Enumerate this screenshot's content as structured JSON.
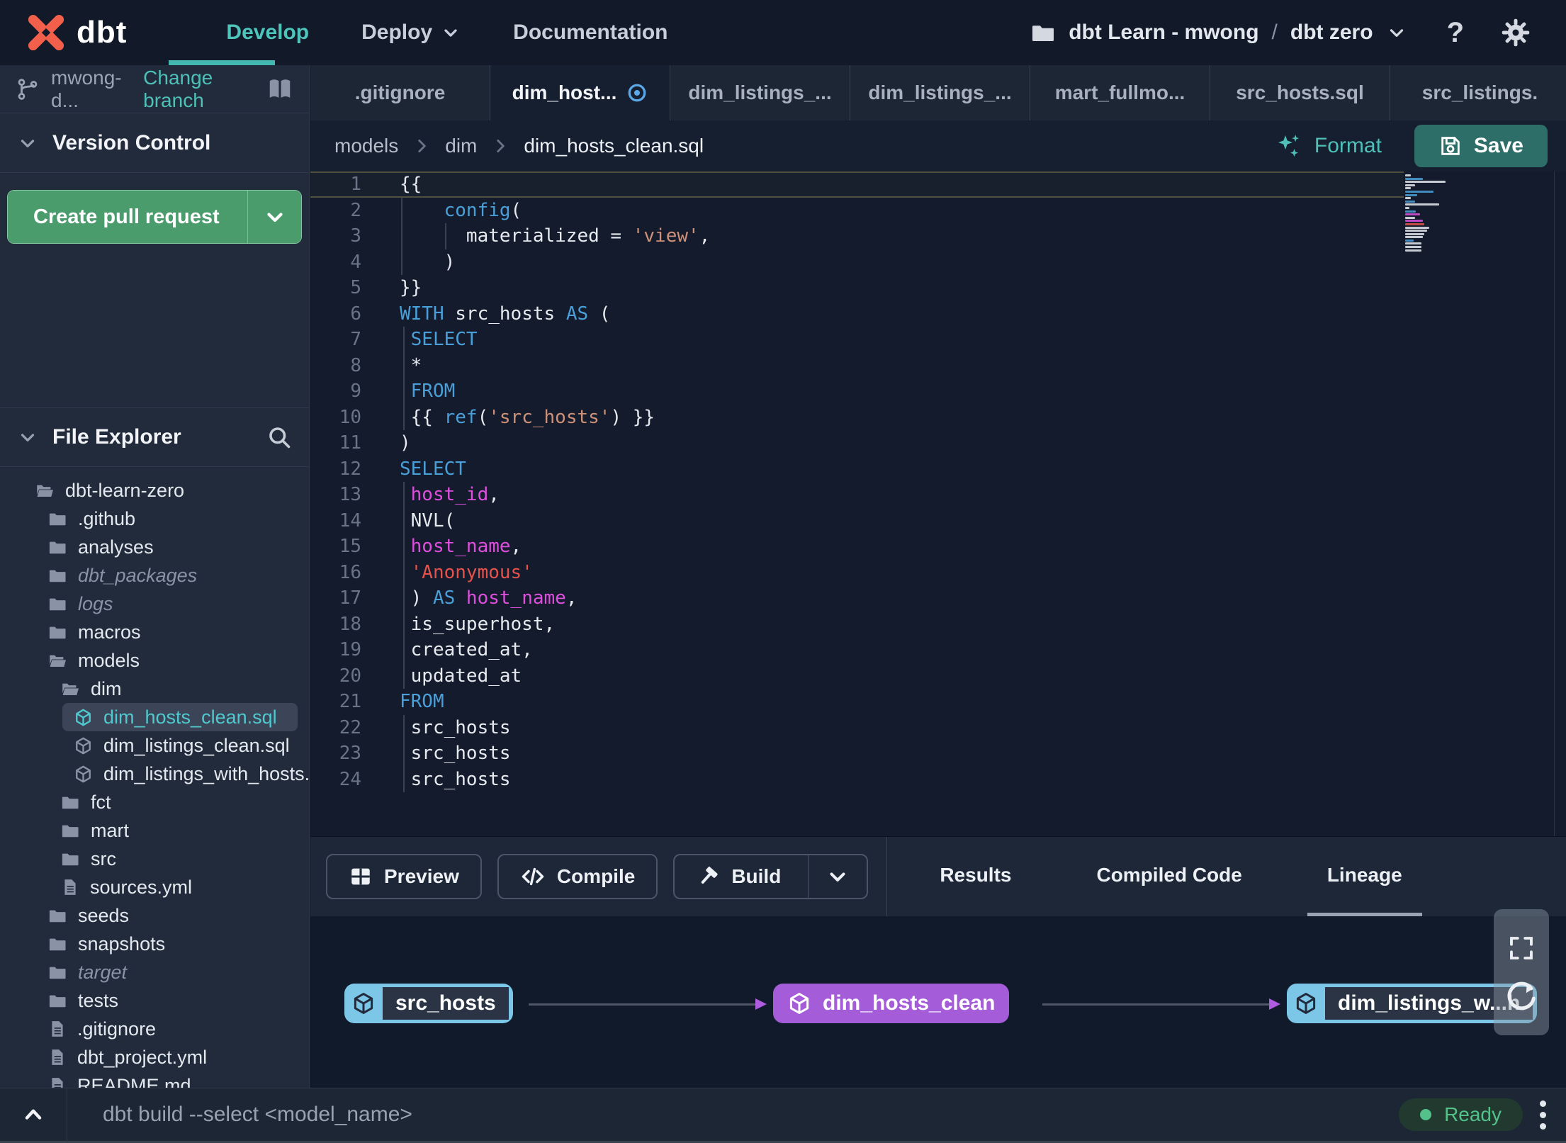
{
  "nav": {
    "brand": "dbt",
    "items": [
      {
        "label": "Develop",
        "active": true,
        "caret": false
      },
      {
        "label": "Deploy",
        "active": false,
        "caret": true
      },
      {
        "label": "Documentation",
        "active": false,
        "caret": false
      }
    ],
    "project_breadcrumb": {
      "account": "dbt Learn - mwong",
      "divider": "/",
      "project": "dbt zero",
      "folder_icon": "folder-icon",
      "caret_icon": "chevron-down-icon"
    },
    "help_icon": "question-mark-icon",
    "settings_icon": "gear-icon"
  },
  "sidebar": {
    "branch": {
      "icon": "git-branch-icon",
      "name": "mwong-d...",
      "change_link": "Change branch",
      "docs_icon": "book-icon"
    },
    "version_control": {
      "title": "Version Control",
      "create_pr_label": "Create pull request"
    },
    "file_explorer": {
      "title": "File Explorer",
      "search_icon": "search-icon",
      "tree": [
        {
          "label": "dbt-learn-zero",
          "type": "folder-open",
          "level": 0
        },
        {
          "label": ".github",
          "type": "folder",
          "level": 1
        },
        {
          "label": "analyses",
          "type": "folder",
          "level": 1
        },
        {
          "label": "dbt_packages",
          "type": "folder",
          "level": 1,
          "muted": true
        },
        {
          "label": "logs",
          "type": "folder",
          "level": 1,
          "muted": true
        },
        {
          "label": "macros",
          "type": "folder",
          "level": 1
        },
        {
          "label": "models",
          "type": "folder-open",
          "level": 1
        },
        {
          "label": "dim",
          "type": "folder-open",
          "level": 2
        },
        {
          "label": "dim_hosts_clean.sql",
          "type": "model",
          "level": 3,
          "selected": true,
          "modified": true
        },
        {
          "label": "dim_listings_clean.sql",
          "type": "model",
          "level": 3
        },
        {
          "label": "dim_listings_with_hosts...",
          "type": "model",
          "level": 3
        },
        {
          "label": "fct",
          "type": "folder",
          "level": 2
        },
        {
          "label": "mart",
          "type": "folder",
          "level": 2
        },
        {
          "label": "src",
          "type": "folder",
          "level": 2
        },
        {
          "label": "sources.yml",
          "type": "file",
          "level": 2
        },
        {
          "label": "seeds",
          "type": "folder",
          "level": 1
        },
        {
          "label": "snapshots",
          "type": "folder",
          "level": 1
        },
        {
          "label": "target",
          "type": "folder",
          "level": 1,
          "muted": true
        },
        {
          "label": "tests",
          "type": "folder",
          "level": 1
        },
        {
          "label": ".gitignore",
          "type": "file",
          "level": 1
        },
        {
          "label": "dbt_project.yml",
          "type": "file",
          "level": 1
        },
        {
          "label": "README.md",
          "type": "file",
          "level": 1
        }
      ]
    }
  },
  "editor": {
    "tabs": [
      {
        "label": ".gitignore",
        "active": false,
        "modified": false
      },
      {
        "label": "dim_host...",
        "active": true,
        "modified": true
      },
      {
        "label": "dim_listings_...",
        "active": false,
        "modified": false
      },
      {
        "label": "dim_listings_...",
        "active": false,
        "modified": false
      },
      {
        "label": "mart_fullmo...",
        "active": false,
        "modified": false
      },
      {
        "label": "src_hosts.sql",
        "active": false,
        "modified": false
      },
      {
        "label": "src_listings.",
        "active": false,
        "modified": false
      }
    ],
    "new_tab_icon": "plus-icon",
    "breadcrumb": [
      "models",
      "dim",
      "dim_hosts_clean.sql"
    ],
    "format_label": "Format",
    "save_label": "Save",
    "lines": [
      {
        "n": 1,
        "a": true,
        "t": [
          [
            "p",
            "{{"
          ]
        ]
      },
      {
        "n": 2,
        "t": [
          [
            "p",
            "    "
          ],
          [
            "k",
            "config"
          ],
          [
            "p",
            "("
          ]
        ]
      },
      {
        "n": 3,
        "t": [
          [
            "p",
            "      materialized = "
          ],
          [
            "s",
            "'view'"
          ],
          [
            "p",
            ","
          ]
        ]
      },
      {
        "n": 4,
        "t": [
          [
            "p",
            "    )"
          ]
        ]
      },
      {
        "n": 5,
        "t": [
          [
            "p",
            "}}"
          ]
        ]
      },
      {
        "n": 6,
        "t": [
          [
            "k",
            "WITH"
          ],
          [
            "p",
            " src_hosts "
          ],
          [
            "k",
            "AS"
          ],
          [
            "p",
            " ("
          ]
        ]
      },
      {
        "n": 7,
        "t": [
          [
            "k",
            " SELECT"
          ]
        ]
      },
      {
        "n": 8,
        "t": [
          [
            "p",
            " *"
          ]
        ]
      },
      {
        "n": 9,
        "t": [
          [
            "k",
            " FROM"
          ]
        ]
      },
      {
        "n": 10,
        "t": [
          [
            "p",
            " {{ "
          ],
          [
            "k",
            "ref"
          ],
          [
            "p",
            "("
          ],
          [
            "s",
            "'src_hosts'"
          ],
          [
            "p",
            ") }}"
          ]
        ]
      },
      {
        "n": 11,
        "t": [
          [
            "p",
            ")"
          ]
        ]
      },
      {
        "n": 12,
        "t": [
          [
            "k",
            "SELECT"
          ]
        ]
      },
      {
        "n": 13,
        "t": [
          [
            "f",
            " host_id"
          ],
          [
            "p",
            ","
          ]
        ]
      },
      {
        "n": 14,
        "t": [
          [
            "p",
            " NVL("
          ]
        ]
      },
      {
        "n": 15,
        "t": [
          [
            "f",
            " host_name"
          ],
          [
            "p",
            ","
          ]
        ]
      },
      {
        "n": 16,
        "t": [
          [
            "r",
            " 'Anonymous'"
          ]
        ]
      },
      {
        "n": 17,
        "t": [
          [
            "p",
            " ) "
          ],
          [
            "k",
            "AS"
          ],
          [
            "f",
            " host_name"
          ],
          [
            "p",
            ","
          ]
        ]
      },
      {
        "n": 18,
        "t": [
          [
            "p",
            " is_superhost,"
          ]
        ]
      },
      {
        "n": 19,
        "t": [
          [
            "p",
            " created_at,"
          ]
        ]
      },
      {
        "n": 20,
        "t": [
          [
            "p",
            " updated_at"
          ]
        ]
      },
      {
        "n": 21,
        "t": [
          [
            "k",
            "FROM"
          ]
        ]
      },
      {
        "n": 22,
        "t": [
          [
            "p",
            " src_hosts"
          ]
        ]
      },
      {
        "n": 23,
        "t": [
          [
            "p",
            " src_hosts"
          ]
        ]
      },
      {
        "n": 24,
        "t": [
          [
            "p",
            " src_hosts"
          ]
        ]
      }
    ]
  },
  "panel": {
    "actions": [
      {
        "label": "Preview",
        "icon": "table-icon",
        "split": false
      },
      {
        "label": "Compile",
        "icon": "code-icon",
        "split": false
      },
      {
        "label": "Build",
        "icon": "hammer-icon",
        "split": true
      }
    ],
    "tabs": [
      {
        "label": "Results",
        "active": false
      },
      {
        "label": "Compiled Code",
        "active": false
      },
      {
        "label": "Lineage",
        "active": true
      }
    ],
    "lineage": {
      "nodes": [
        {
          "label": "src_hosts",
          "style": "source"
        },
        {
          "label": "dim_hosts_clean",
          "style": "primary"
        },
        {
          "label": "dim_listings_w...h",
          "style": "source"
        }
      ],
      "controls": [
        "fullscreen-icon",
        "refresh-icon"
      ]
    }
  },
  "statusbar": {
    "command": "dbt build --select <model_name>",
    "status": "Ready"
  },
  "colors": {
    "brand_orange": "#F2604C",
    "accent_teal": "#4FC0B8",
    "pr_green": "#4A9C6D",
    "save_teal": "#2E6E69",
    "status_green": "#54C08A",
    "node_blue": "#7CC6E8",
    "node_purple": "#A55CD9",
    "code_keyword": "#4B9FD8",
    "code_string_jinja": "#CE9178",
    "code_string_sql": "#E5534B",
    "code_field": "#DE4FDE"
  }
}
